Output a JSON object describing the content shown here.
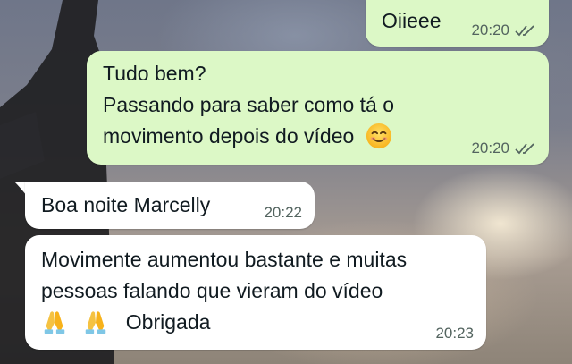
{
  "conversation": {
    "messages": [
      {
        "direction": "outgoing",
        "text": "Oiieee",
        "time": "20:20",
        "status_icon": "double-check-icon"
      },
      {
        "direction": "outgoing",
        "text_line1": "Tudo bem?",
        "text_line2": "Passando para saber como tá o",
        "text_line3": "movimento depois do vídeo",
        "emoji": "smiling-face-icon",
        "time": "20:20",
        "status_icon": "double-check-icon"
      },
      {
        "direction": "incoming",
        "text": "Boa noite Marcelly",
        "time": "20:22"
      },
      {
        "direction": "incoming",
        "text_line1": "Movimente aumentou bastante e muitas",
        "text_line2": "pessoas falando que vieram do vídeo",
        "emoji": "folded-hands-icon",
        "text_line3": "Obrigada",
        "time": "20:23"
      }
    ]
  },
  "colors": {
    "outgoing_bubble": "#dcf8c6",
    "incoming_bubble": "#ffffff",
    "meta_text": "#53645f"
  }
}
